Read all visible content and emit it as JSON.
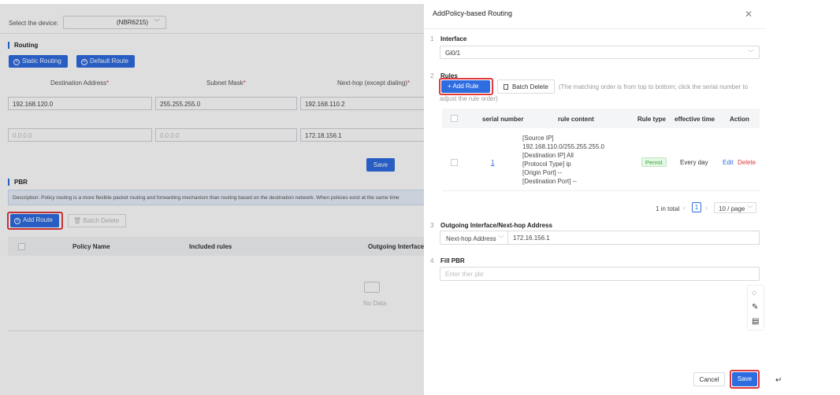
{
  "background": {
    "device_label": "Select the device:",
    "device_value": "(NBR6215)",
    "routing_title": "Routing",
    "static_routing_btn": "Static Routing",
    "default_route_btn": "Default Route",
    "columns": [
      "Destination Address",
      "Subnet Mask",
      "Next-hop (except dialing)"
    ],
    "required_mark": "*",
    "row1": {
      "dest": "192.168.120.0",
      "mask": "255.255.255.0",
      "next": "192.168.110.2"
    },
    "row2": {
      "dest": "0.0.0.0",
      "mask": "0.0.0.0",
      "next": "172.18.156.1"
    },
    "save_btn": "Save",
    "pbr_title": "PBR",
    "description": "Description: Policy routing is a more flexible packet routing and forwarding mechanism than routing based on the destination network. When policies exist at the same time",
    "add_route_btn": "Add Route",
    "batch_delete_btn": "Batch Delete",
    "table_headers": [
      "Policy Name",
      "Included rules",
      "Outgoing Interface"
    ],
    "no_data": "No Data"
  },
  "drawer": {
    "title": "AddPolicy-based Routing",
    "steps": [
      {
        "num": "1",
        "title": "Interface"
      },
      {
        "num": "2",
        "title": "Rules"
      },
      {
        "num": "3",
        "title": "Outgoing Interface/Next-hop Address"
      },
      {
        "num": "4",
        "title": "Fill PBR"
      }
    ],
    "interface_value": "Gi0/1",
    "add_rule_btn": "+ Add Rule",
    "batch_delete_btn": "Batch Delete",
    "rules_note_1": "(The matching order is from top to bottom; click the serial number to",
    "rules_note_2": "adjust the rule order)",
    "rules_table": {
      "headers": [
        "serial number",
        "rule content",
        "Rule type",
        "effective time",
        "Action"
      ],
      "row": {
        "serial": "1",
        "content": [
          "[Source IP]",
          "192.168.110.0/255.255.255.0",
          "[Destination IP] All",
          "[Protocol Type] ip",
          "[Origin Port] --",
          "[Destination Port] --"
        ],
        "rule_type": "Permit",
        "effective_time": "Every day",
        "edit": "Edit",
        "delete": "Delete"
      }
    },
    "pagination": {
      "total": "1 in total",
      "page": "1",
      "page_size": "10 / page"
    },
    "next_hop_type": "Next-hop Address",
    "next_hop_value": "172.16.156.1",
    "pbr_placeholder": "Enter ther pbr",
    "cancel_btn": "Cancel",
    "save_btn": "Save"
  },
  "colors": {
    "primary": "#2e6de0",
    "highlight": "#e03a3a",
    "permit": "#3aa63a"
  }
}
